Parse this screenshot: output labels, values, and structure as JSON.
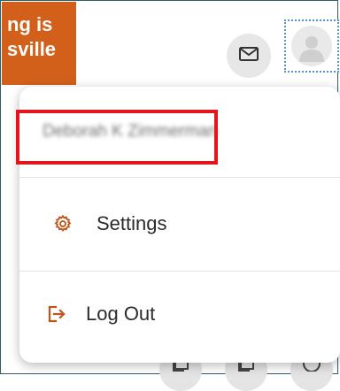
{
  "banner": {
    "line1": "ng is",
    "line2": "sville"
  },
  "header": {
    "mail_icon": "mail-icon",
    "avatar_icon": "user-avatar-icon"
  },
  "menu": {
    "user_name": "Deborah K Zimmerman",
    "items": [
      {
        "label": "Settings",
        "icon": "gear-icon"
      },
      {
        "label": "Log Out",
        "icon": "logout-icon"
      }
    ]
  },
  "colors": {
    "banner": "#d2601a",
    "icon_accent": "#c0531a",
    "highlight": "#e3161d",
    "avatar_focus": "#4f92d9"
  }
}
